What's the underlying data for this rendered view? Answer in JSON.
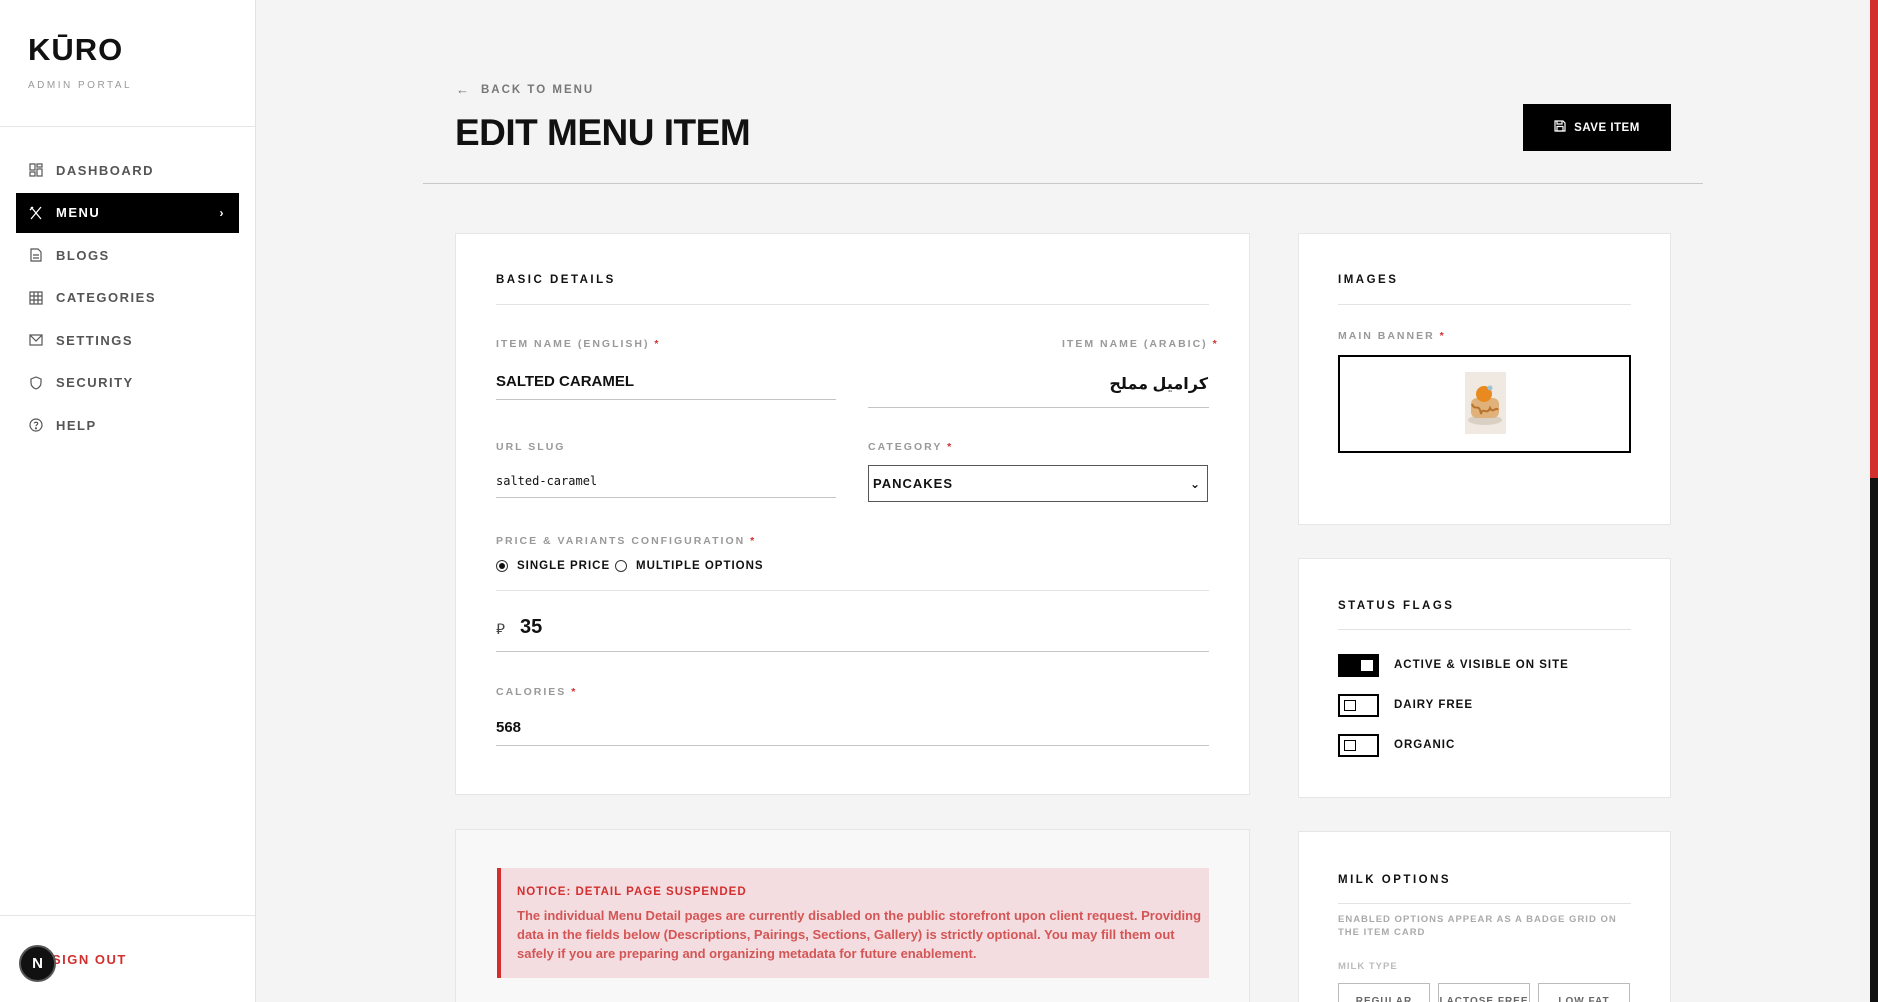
{
  "brand": {
    "name": "KŪRO",
    "subtitle": "ADMIN PORTAL"
  },
  "nav": {
    "items": [
      {
        "label": "DASHBOARD",
        "icon": "dashboard-icon"
      },
      {
        "label": "MENU",
        "icon": "utensils-icon",
        "active": true
      },
      {
        "label": "BLOGS",
        "icon": "document-icon"
      },
      {
        "label": "CATEGORIES",
        "icon": "grid-icon"
      },
      {
        "label": "SETTINGS",
        "icon": "mail-icon"
      },
      {
        "label": "SECURITY",
        "icon": "shield-icon"
      },
      {
        "label": "HELP",
        "icon": "help-icon"
      }
    ],
    "signout": "SIGN OUT",
    "badge": "N"
  },
  "header": {
    "back": "BACK TO MENU",
    "title": "EDIT MENU ITEM",
    "save": "SAVE ITEM"
  },
  "basic": {
    "title": "BASIC DETAILS",
    "name_en_label": "ITEM NAME (ENGLISH)",
    "name_en": "SALTED CARAMEL",
    "name_ar_label": "ITEM NAME (ARABIC)",
    "name_ar": "كراميل مملح",
    "slug_label": "URL SLUG",
    "slug": "salted-caramel",
    "category_label": "CATEGORY",
    "category": "PANCAKES",
    "price_label": "PRICE & VARIANTS CONFIGURATION",
    "single": "SINGLE PRICE",
    "multiple": "MULTIPLE OPTIONS",
    "currency": "⃁",
    "price": "35",
    "calories_label": "CALORIES",
    "calories": "568",
    "required": "*"
  },
  "images": {
    "title": "IMAGES",
    "banner_label": "MAIN BANNER"
  },
  "flags": {
    "title": "STATUS FLAGS",
    "items": [
      {
        "label": "ACTIVE & VISIBLE ON SITE",
        "on": true
      },
      {
        "label": "DAIRY FREE",
        "on": false
      },
      {
        "label": "ORGANIC",
        "on": false
      }
    ]
  },
  "notice": {
    "title": "NOTICE: DETAIL PAGE SUSPENDED",
    "body": "The individual Menu Detail pages are currently disabled on the public storefront upon client request. Providing data in the fields below (Descriptions, Pairings, Sections, Gallery) is strictly optional. You may fill them out safely if you are preparing and organizing metadata for future enablement."
  },
  "milk": {
    "title": "MILK OPTIONS",
    "note": "ENABLED OPTIONS APPEAR AS A BADGE GRID ON THE ITEM CARD",
    "type_label": "MILK TYPE",
    "options": [
      "REGULAR",
      "LACTOSE FREE",
      "LOW FAT"
    ]
  },
  "colors": {
    "accent": "#d32f2f",
    "primary": "#000000",
    "background": "#f4f4f4"
  }
}
